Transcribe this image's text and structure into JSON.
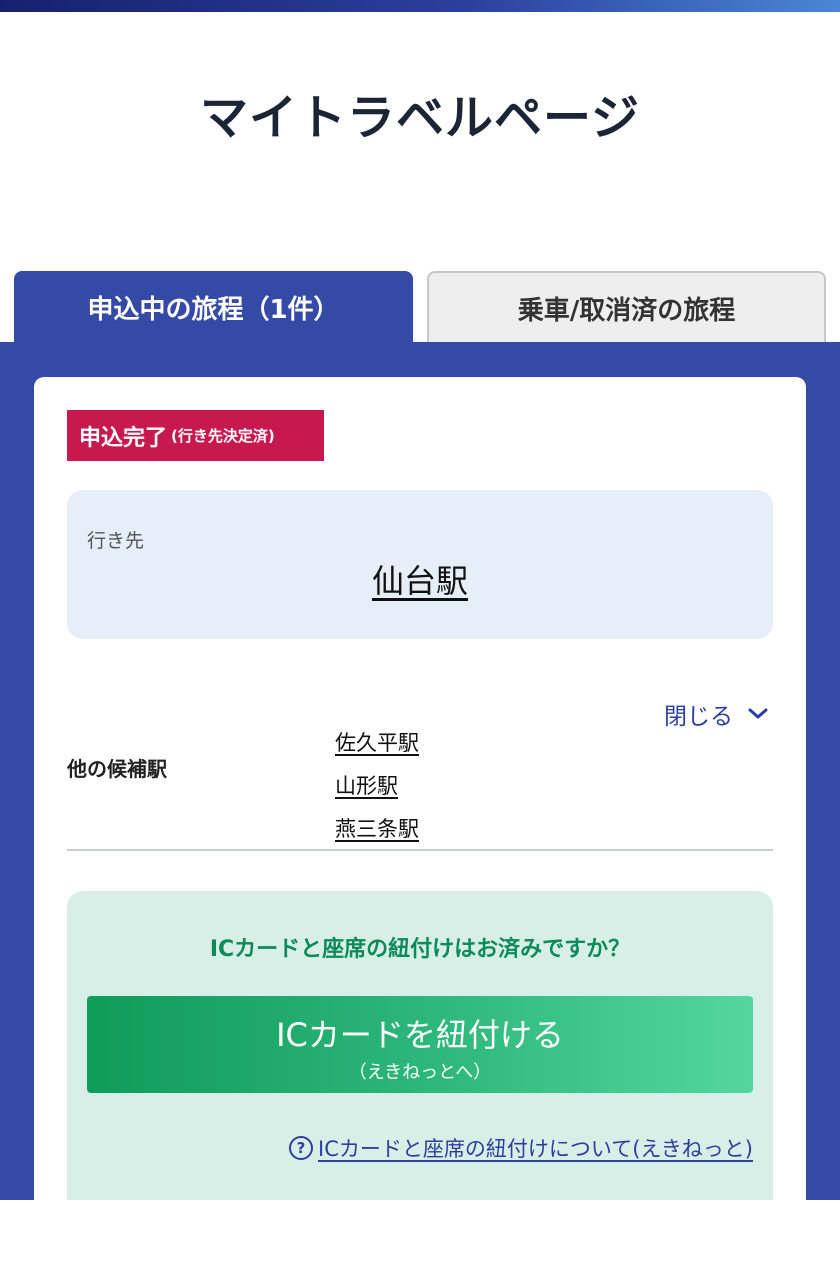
{
  "page": {
    "title": "マイトラベルページ"
  },
  "tabs": [
    {
      "label": "申込中の旅程（1件）",
      "active": true
    },
    {
      "label": "乗車/取消済の旅程",
      "active": false
    }
  ],
  "trip": {
    "status_main": "申込完了",
    "status_sub": "(行き先決定済)",
    "destination_label": "行き先",
    "destination_station": "仙台駅",
    "close_label": "閉じる",
    "other_candidates_label": "他の候補駅",
    "other_candidates": [
      "佐久平駅",
      "山形駅",
      "燕三条駅"
    ]
  },
  "ic": {
    "question": "ICカードと座席の紐付けはお済みですか？",
    "button_main": "ICカードを紐付ける",
    "button_sub": "（えきねっとへ）",
    "help_icon_glyph": "?",
    "help_link": "ICカードと座席の紐付けについて(えきねっと)"
  },
  "colors": {
    "brand_blue": "#3549a6",
    "status_red": "#c8194f",
    "ic_green": "#0c8a59",
    "destination_bg": "#e6eef7",
    "ic_bg": "#d8efe7"
  }
}
